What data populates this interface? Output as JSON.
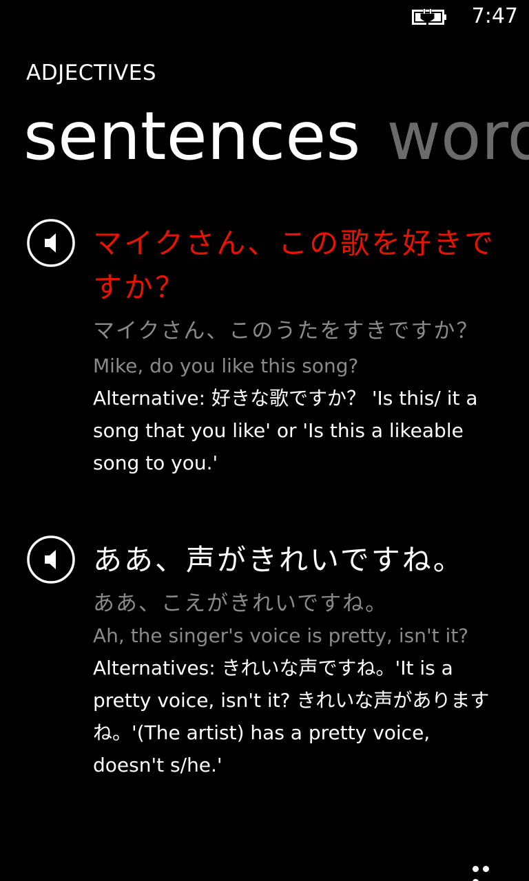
{
  "status_bar": {
    "time": "7:47",
    "battery_icon": "battery-charging-icon"
  },
  "header": {
    "app_title": "ADJECTIVES",
    "tabs": [
      {
        "label": "sentences",
        "active": true
      },
      {
        "label": "words",
        "active": false
      }
    ]
  },
  "items": [
    {
      "play_icon": "speaker-icon",
      "japanese": "マイクさん、この歌を好きですか？",
      "japanese_color": "#e51400",
      "kana": "マイクさん、このうたをすきですか？",
      "english": "Mike, do you like this song?",
      "note": "Alternative: 好きな歌ですか？ 'Is this/ it a song that you like' or 'Is this a likeable song to you.'"
    },
    {
      "play_icon": "speaker-icon",
      "japanese": "ああ、声がきれいですね。",
      "japanese_color": "#ffffff",
      "kana": "ああ、こえがきれいですね。",
      "english": "Ah, the singer's voice is pretty, isn't it?",
      "note": "Alternatives: きれいな声ですね。'It is a pretty voice, isn't it? きれいな声がありますね。'(The artist) has a pretty voice, doesn't s/he.'"
    }
  ],
  "app_bar": {
    "more_icon": "ellipsis-icon"
  },
  "colors": {
    "accent": "#e51400",
    "subtle": "#8a8a8a",
    "inactive_tab": "#6b6b6b"
  }
}
